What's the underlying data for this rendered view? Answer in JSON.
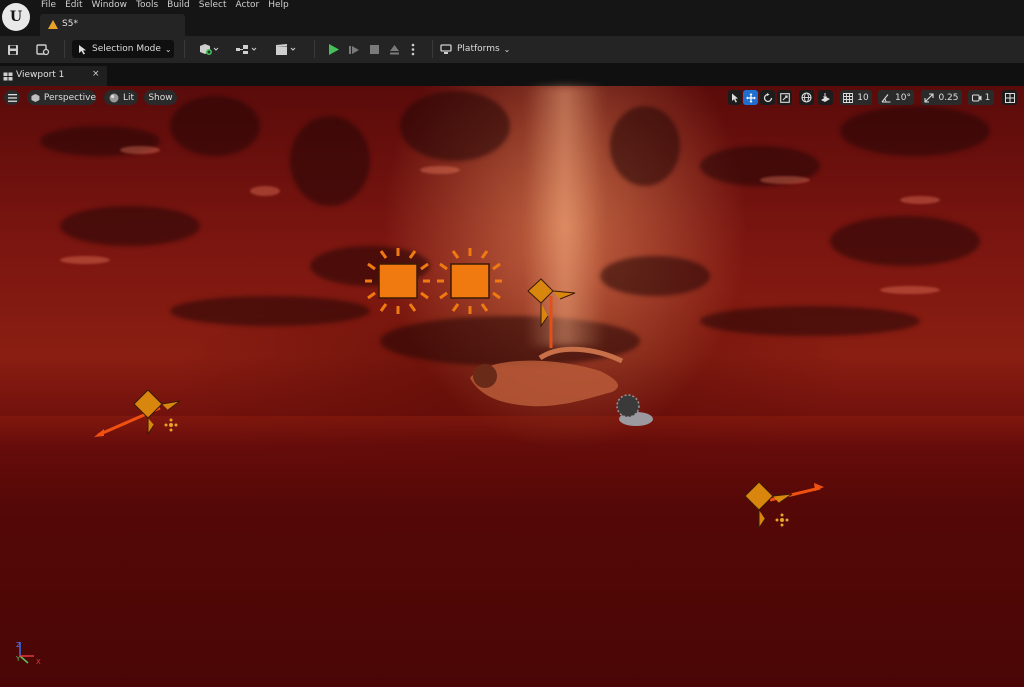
{
  "menu": {
    "items": [
      "File",
      "Edit",
      "Window",
      "Tools",
      "Build",
      "Select",
      "Actor",
      "Help"
    ]
  },
  "document_tab": {
    "name": "S5*"
  },
  "toolbar": {
    "selection_mode": "Selection Mode",
    "platforms": "Platforms"
  },
  "viewport_tab": {
    "name": "Viewport 1",
    "close": "×"
  },
  "viewport": {
    "perspective": "Perspective",
    "lit": "Lit",
    "show": "Show",
    "grid_snap": "10",
    "rotation_snap": "10°",
    "scale_snap": "0.25",
    "camera_speed": "1"
  },
  "gizmo": {
    "x": "X",
    "y": "Y",
    "z": "Z"
  },
  "colors": {
    "accent_orange": "#f07a10",
    "icon_orange": "#d9860f",
    "play_green": "#46c05a",
    "warn_yellow": "#e8a32a",
    "water_red": "#7a1510"
  }
}
